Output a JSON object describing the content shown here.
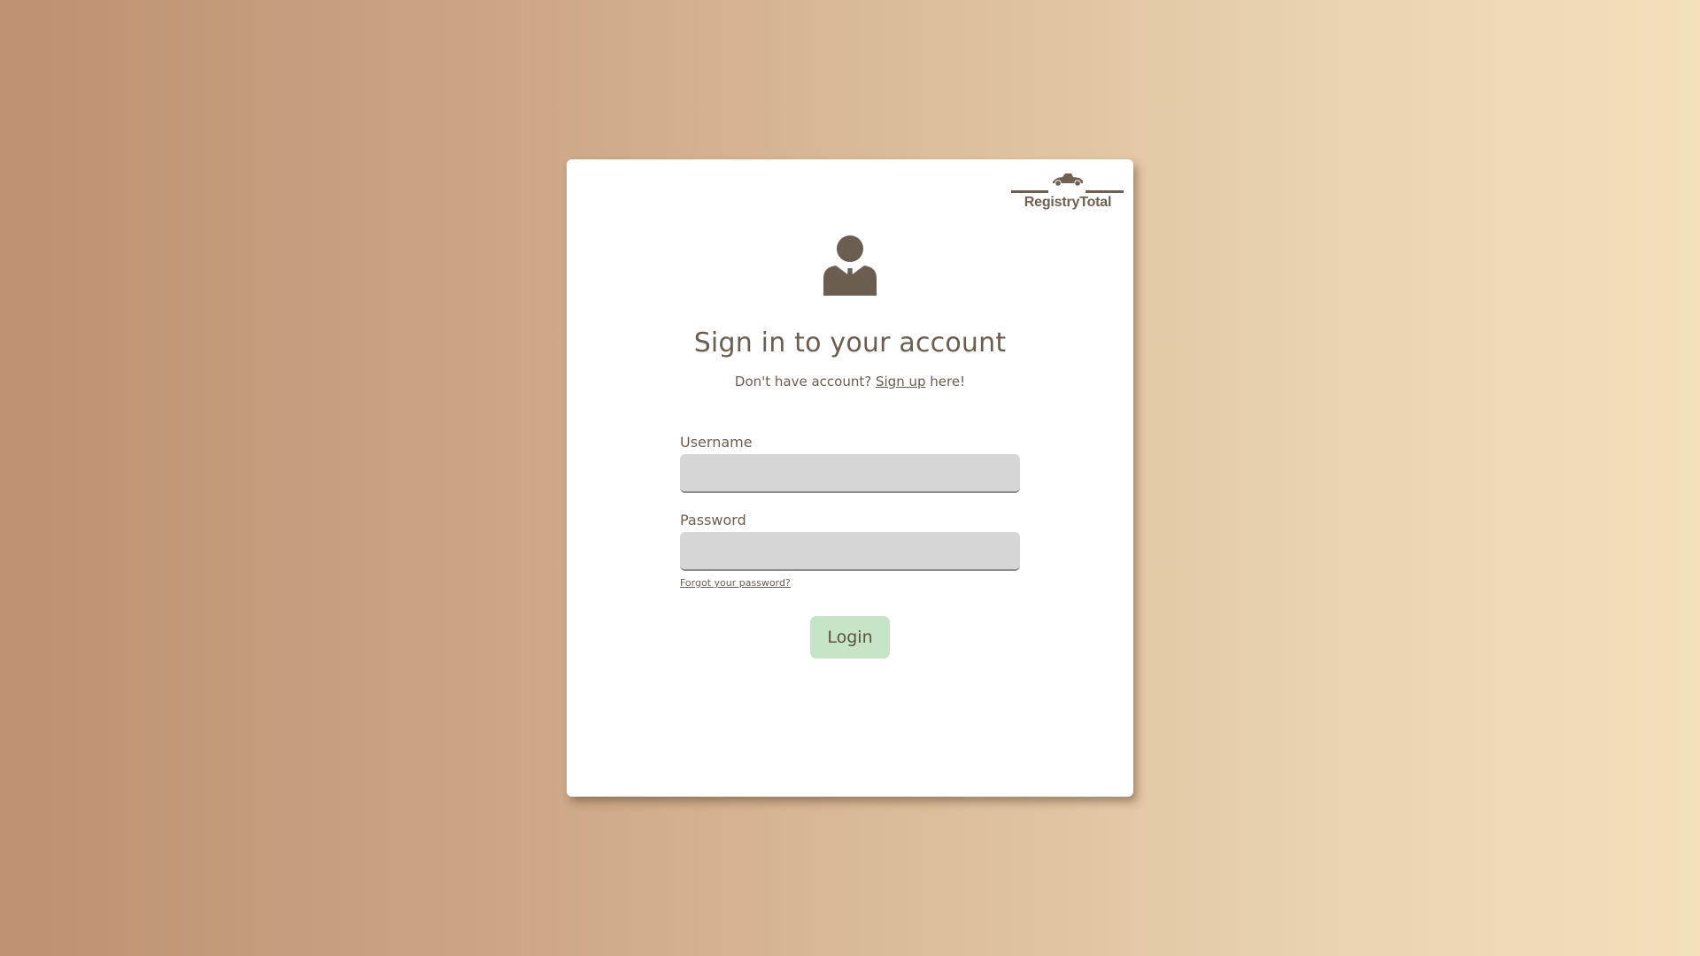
{
  "brand": {
    "name": "RegistryTotal",
    "logo_icon": "car-icon"
  },
  "avatar": {
    "icon": "user-suit-icon"
  },
  "heading": {
    "title": "Sign in to your account",
    "prompt_before": "Don't have account?",
    "signup_link": "Sign up",
    "prompt_after": "here!"
  },
  "form": {
    "username_label": "Username",
    "username_value": "",
    "password_label": "Password",
    "password_value": "",
    "forgot_link": "Forgot your password?",
    "login_label": "Login"
  },
  "colors": {
    "text": "#6b5e51",
    "login_button": "#c6e5c8",
    "input_background": "#d6d6d6",
    "gradient_left": "#be9170",
    "gradient_right": "#f3e0bb"
  }
}
